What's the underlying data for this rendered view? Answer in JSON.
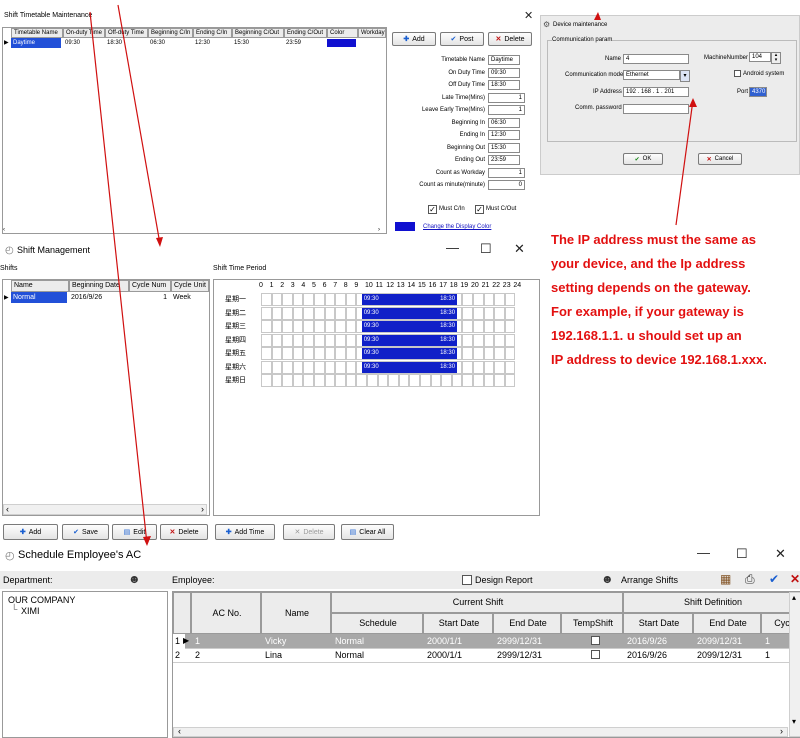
{
  "stm": {
    "title": "Shift Timetable Maintenance",
    "columns": [
      "Timetable Name",
      "On-duty Time",
      "Off-duty Time",
      "Beginning C/In",
      "Ending C/In",
      "Beginning C/Out",
      "Ending C/Out",
      "Color",
      "Workday"
    ],
    "row": [
      "Daytime",
      "09:30",
      "18:30",
      "06:30",
      "12:30",
      "15:30",
      "23:59"
    ],
    "buttons": {
      "add": "Add",
      "post": "Post",
      "delete": "Delete"
    },
    "form": [
      {
        "label": "Timetable Name",
        "value": "Daytime"
      },
      {
        "label": "On Duty Time",
        "value": "09:30"
      },
      {
        "label": "Off Duty Time",
        "value": "18:30"
      },
      {
        "label": "Late Time(Mins)",
        "value": "1"
      },
      {
        "label": "Leave Early Time(Mins)",
        "value": "1"
      },
      {
        "label": "Beginning In",
        "value": "06:30"
      },
      {
        "label": "Ending In",
        "value": "12:30"
      },
      {
        "label": "Beginning Out",
        "value": "15:30"
      },
      {
        "label": "Ending Out",
        "value": "23:59"
      },
      {
        "label": "Count as Workday",
        "value": "1"
      },
      {
        "label": "Count as minute(minute)",
        "value": "0"
      }
    ],
    "must_cin": "Must C/In",
    "must_cout": "Must C/Out",
    "change_color": "Change the Display Color"
  },
  "dm": {
    "title": "Device maintenance",
    "group": "Communication param",
    "name_label": "Name",
    "name_value": "4",
    "machine_label": "MachineNumber",
    "machine_value": "104",
    "mode_label": "Communication mode",
    "mode_value": "Ethernet",
    "android_label": "Android system",
    "ip_label": "IP Address",
    "ip_value": "192 . 168 . 1 . 201",
    "port_label": "Port",
    "port_value": "4370",
    "pwd_label": "Comm. password",
    "ok": "OK",
    "cancel": "Cancel"
  },
  "note": [
    "The IP address must the same as",
    "your device, and the Ip address",
    "setting depends on the gateway.",
    "For example, if your gateway is",
    "192.168.1.1. u should set up an",
    "IP address to device 192.168.1.xxx."
  ],
  "sm": {
    "title": "Shift Management",
    "shifts_label": "Shifts",
    "columns": [
      "Name",
      "Beginning Date",
      "Cycle Num",
      "Cycle Unit"
    ],
    "row": [
      "Normal",
      "2016/9/26",
      "1",
      "Week"
    ],
    "period_label": "Shift Time Period",
    "hours": [
      "0",
      "1",
      "2",
      "3",
      "4",
      "5",
      "6",
      "7",
      "8",
      "9",
      "10",
      "11",
      "12",
      "13",
      "14",
      "15",
      "16",
      "17",
      "18",
      "19",
      "20",
      "21",
      "22",
      "23",
      "24"
    ],
    "days": [
      "星期一",
      "星期二",
      "星期三",
      "星期四",
      "星期五",
      "星期六",
      "星期日"
    ],
    "bar_start": "09:30",
    "bar_end": "18:30",
    "buttons": {
      "add": "Add",
      "save": "Save",
      "edit": "Edit",
      "delete": "Delete",
      "add_time": "Add Time",
      "delete_time": "Delete",
      "clear_all": "Clear All"
    }
  },
  "sea": {
    "title": "Schedule Employee's AC",
    "department_label": "Department:",
    "employee_label": "Employee:",
    "design_report": "Design Report",
    "arrange_shifts": "Arrange Shifts",
    "tree": [
      "OUR COMPANY",
      "XIMI"
    ],
    "group_current": "Current Shift",
    "group_def": "Shift Definition",
    "columns": [
      "AC No.",
      "Name",
      "Schedule",
      "Start Date",
      "End Date",
      "TempShift",
      "Start Date",
      "End Date",
      "Cyc"
    ],
    "rows": [
      {
        "num": "1",
        "ac": "1",
        "name": "Vicky",
        "schedule": "Normal",
        "start": "2000/1/1",
        "end": "2999/12/31",
        "def_start": "2016/9/26",
        "def_end": "2099/12/31",
        "cyc": "1"
      },
      {
        "num": "2",
        "ac": "2",
        "name": "Lina",
        "schedule": "Normal",
        "start": "2000/1/1",
        "end": "2999/12/31",
        "def_start": "2016/9/26",
        "def_end": "2099/12/31",
        "cyc": "1"
      }
    ]
  }
}
